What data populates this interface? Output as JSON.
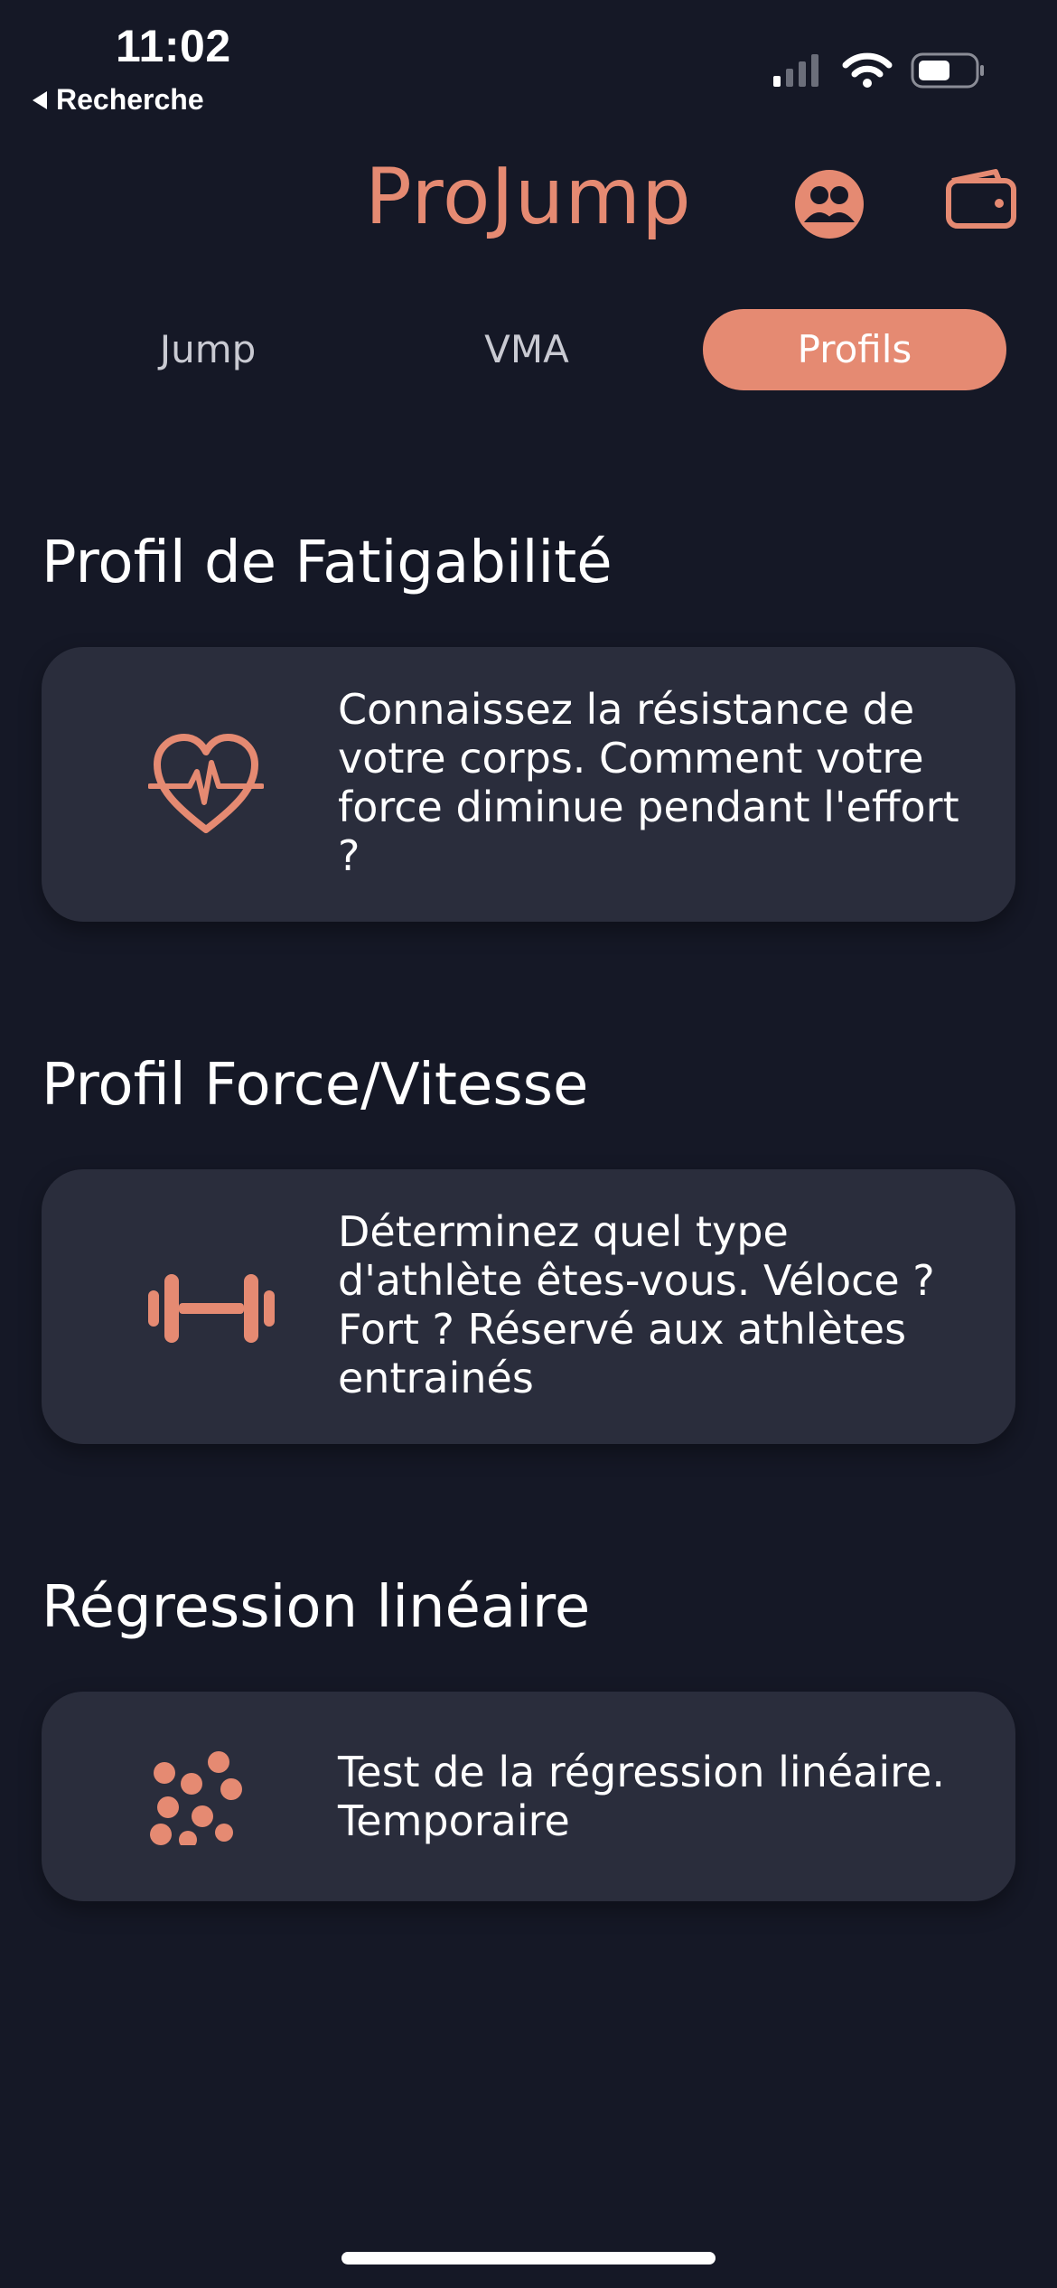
{
  "status_bar": {
    "time": "11:02",
    "back_label": "Recherche"
  },
  "header": {
    "title": "ProJump",
    "icons": [
      "profile-group-icon",
      "wallet-icon"
    ]
  },
  "tabs": [
    {
      "label": "Jump",
      "active": false
    },
    {
      "label": "VMA",
      "active": false
    },
    {
      "label": "Profils",
      "active": true
    }
  ],
  "sections": [
    {
      "title": "Profil de Fatigabilité",
      "icon": "heart-pulse-icon",
      "description": "Connaissez la résistance de votre corps. Comment votre force diminue pendant l'effort ?"
    },
    {
      "title": "Profil Force/Vitesse",
      "icon": "dumbbell-icon",
      "description": "Déterminez quel type d'athlète êtes-vous. Véloce ? Fort ? Réservé aux athlètes entrainés"
    },
    {
      "title": "Régression linéaire",
      "icon": "scatter-dots-icon",
      "description": "Test de la régression linéaire. Temporaire"
    }
  ],
  "colors": {
    "background": "#151826",
    "card": "#2A2D3C",
    "accent": "#E58A72",
    "text": "#FFFFFF",
    "tab_inactive_text": "#C9CAD2"
  }
}
